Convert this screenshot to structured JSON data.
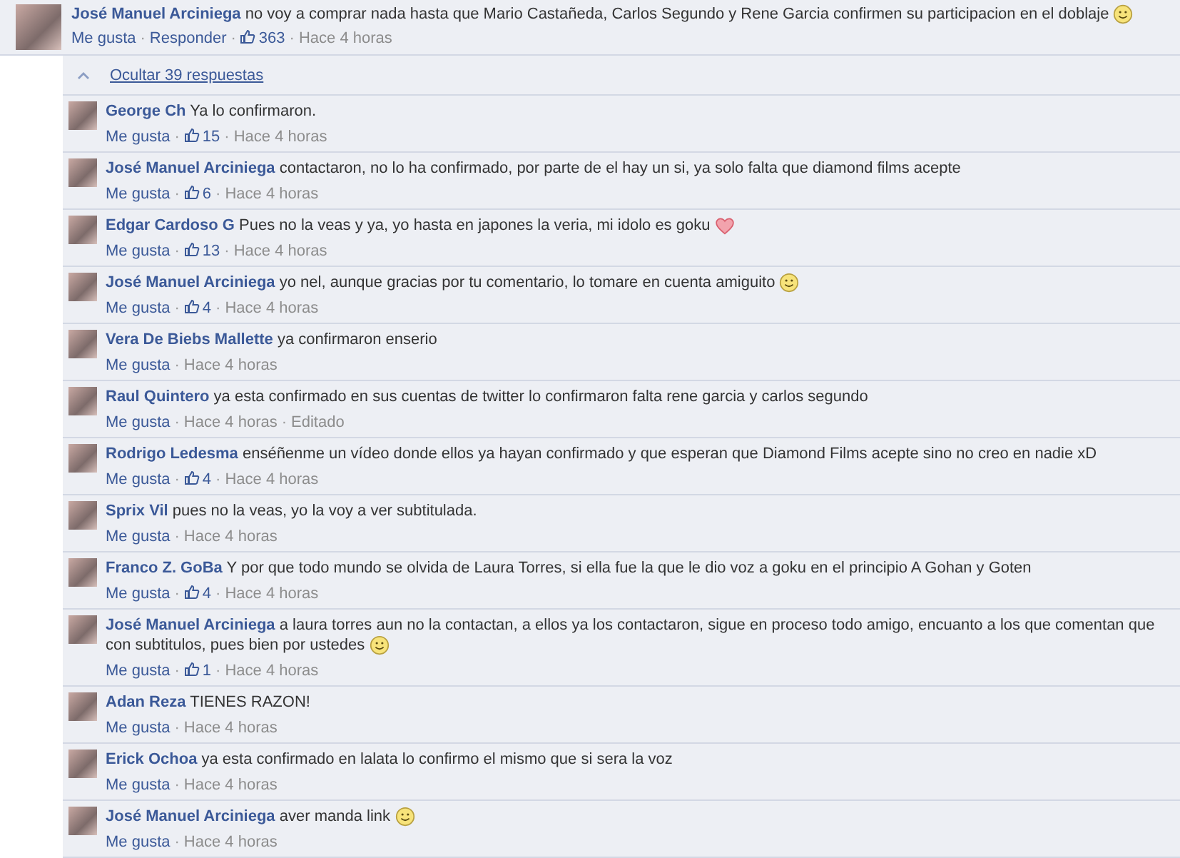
{
  "separator": "·",
  "comment": {
    "author": "José Manuel Arciniega",
    "text": "no voy a comprar nada hasta que Mario Castañeda, Carlos Segundo y Rene Garcia confirmen su participacion en el doblaje",
    "emoticon": {
      "kind": "smile"
    },
    "meta": [
      {
        "kind": "link",
        "text": "Me gusta"
      },
      {
        "kind": "link",
        "text": "Responder"
      },
      {
        "kind": "likes",
        "text": "363"
      },
      {
        "kind": "time",
        "text": "Hace 4 horas"
      }
    ]
  },
  "replies_toggle": {
    "label": "Ocultar 39 respuestas",
    "expanded": true
  },
  "replies": [
    {
      "author": "George Ch",
      "text": "Ya lo confirmaron.",
      "meta": [
        {
          "kind": "link",
          "text": "Me gusta"
        },
        {
          "kind": "likes",
          "text": "15"
        },
        {
          "kind": "time",
          "text": "Hace 4 horas"
        }
      ]
    },
    {
      "author": "José Manuel Arciniega",
      "text": "contactaron, no lo ha confirmado, por parte de el hay un si, ya solo falta que diamond films acepte",
      "meta": [
        {
          "kind": "link",
          "text": "Me gusta"
        },
        {
          "kind": "likes",
          "text": "6"
        },
        {
          "kind": "time",
          "text": "Hace 4 horas"
        }
      ]
    },
    {
      "author": "Edgar Cardoso G",
      "text": "Pues no la veas y ya, yo hasta en japones la veria, mi idolo es goku",
      "emoticon": {
        "kind": "heart"
      },
      "meta": [
        {
          "kind": "link",
          "text": "Me gusta"
        },
        {
          "kind": "likes",
          "text": "13"
        },
        {
          "kind": "time",
          "text": "Hace 4 horas"
        }
      ]
    },
    {
      "author": "José Manuel Arciniega",
      "text": "yo nel, aunque gracias por tu comentario, lo tomare en cuenta amiguito",
      "emoticon": {
        "kind": "smile"
      },
      "meta": [
        {
          "kind": "link",
          "text": "Me gusta"
        },
        {
          "kind": "likes",
          "text": "4"
        },
        {
          "kind": "time",
          "text": "Hace 4 horas"
        }
      ]
    },
    {
      "author": "Vera De Biebs Mallette",
      "text": "ya confirmaron enserio",
      "meta": [
        {
          "kind": "link",
          "text": "Me gusta"
        },
        {
          "kind": "time",
          "text": "Hace 4 horas"
        }
      ]
    },
    {
      "author": "Raul Quintero",
      "text": "ya esta confirmado en sus cuentas de twitter lo confirmaron falta rene garcia y carlos segundo",
      "meta": [
        {
          "kind": "link",
          "text": "Me gusta"
        },
        {
          "kind": "time",
          "text": "Hace 4 horas"
        },
        {
          "kind": "note",
          "text": "Editado"
        }
      ]
    },
    {
      "author": "Rodrigo Ledesma",
      "text": "enséñenme un vídeo donde ellos ya hayan confirmado y que esperan que Diamond Films acepte sino no creo en nadie xD",
      "meta": [
        {
          "kind": "link",
          "text": "Me gusta"
        },
        {
          "kind": "likes",
          "text": "4"
        },
        {
          "kind": "time",
          "text": "Hace 4 horas"
        }
      ]
    },
    {
      "author": "Sprix Vil",
      "text": "pues no la veas, yo la voy a ver subtitulada.",
      "meta": [
        {
          "kind": "link",
          "text": "Me gusta"
        },
        {
          "kind": "time",
          "text": "Hace 4 horas"
        }
      ]
    },
    {
      "author": "Franco Z. GoBa",
      "text": "Y por que todo mundo se olvida de Laura Torres, si ella fue la que le dio voz a goku en el principio A Gohan y Goten",
      "meta": [
        {
          "kind": "link",
          "text": "Me gusta"
        },
        {
          "kind": "likes",
          "text": "4"
        },
        {
          "kind": "time",
          "text": "Hace 4 horas"
        }
      ]
    },
    {
      "author": "José Manuel Arciniega",
      "text": "a laura torres aun no la contactan, a ellos ya los contactaron, sigue en proceso todo amigo, encuanto a los que comentan que con subtitulos, pues bien por ustedes",
      "emoticon": {
        "kind": "smile"
      },
      "meta": [
        {
          "kind": "link",
          "text": "Me gusta"
        },
        {
          "kind": "likes",
          "text": "1"
        },
        {
          "kind": "time",
          "text": "Hace 4 horas"
        }
      ]
    },
    {
      "author": "Adan Reza",
      "text": "TIENES RAZON!",
      "meta": [
        {
          "kind": "link",
          "text": "Me gusta"
        },
        {
          "kind": "time",
          "text": "Hace 4 horas"
        }
      ]
    },
    {
      "author": "Erick Ochoa",
      "text": "ya esta confirmado en lalata lo confirmo el mismo que si sera la voz",
      "meta": [
        {
          "kind": "link",
          "text": "Me gusta"
        },
        {
          "kind": "time",
          "text": "Hace 4 horas"
        }
      ]
    },
    {
      "author": "José Manuel Arciniega",
      "text": "aver manda link",
      "emoticon": {
        "kind": "smile"
      },
      "meta": [
        {
          "kind": "link",
          "text": "Me gusta"
        },
        {
          "kind": "time",
          "text": "Hace 4 horas"
        }
      ]
    }
  ]
}
